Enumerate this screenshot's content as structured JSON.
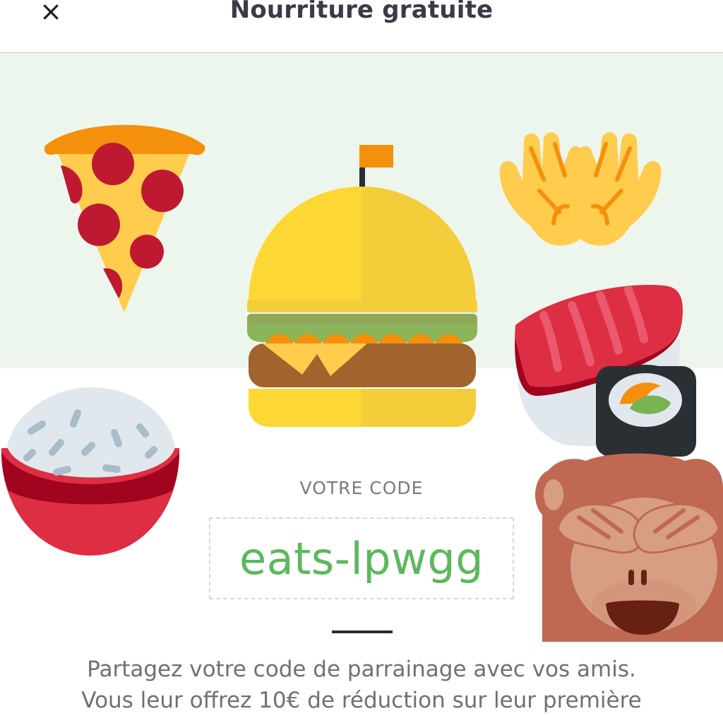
{
  "header": {
    "close_icon": "×",
    "title": "Nourriture gratuite"
  },
  "hero": {
    "background_color": "#edf6ec",
    "icons": [
      "pizza-icon",
      "burger-icon",
      "raised-hands-icon",
      "sushi-icon",
      "rice-bowl-icon",
      "see-no-evil-monkey-icon"
    ]
  },
  "referral": {
    "label": "VOTRE CODE",
    "code": "eats-lpwgg",
    "code_color": "#5cb85c",
    "description_line1": "Partagez votre code de parrainage avec vos amis.",
    "description_line2": "Vous leur offrez 10€ de réduction sur leur première"
  }
}
